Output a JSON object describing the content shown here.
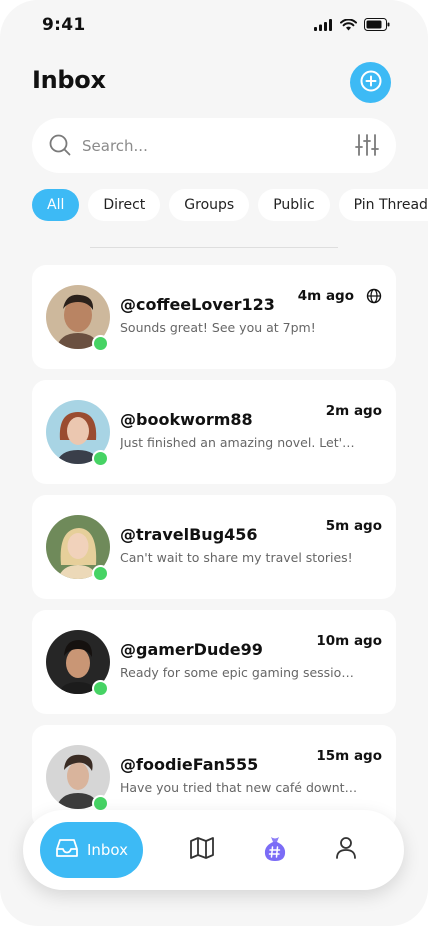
{
  "status_bar": {
    "time": "9:41"
  },
  "header": {
    "title": "Inbox",
    "add_icon": "plus-circle-icon"
  },
  "search": {
    "placeholder": "Search...",
    "value": "",
    "filter_icon": "sliders-icon"
  },
  "filters": [
    "All",
    "Direct",
    "Groups",
    "Public",
    "Pin Threads"
  ],
  "active_filter": "All",
  "messages": [
    {
      "handle": "@coffeeLover123",
      "preview": "Sounds great! See you at 7pm!",
      "time": "4m ago",
      "public": true,
      "online": true
    },
    {
      "handle": "@bookworm88",
      "preview": "Just finished an amazing novel. Let's ...",
      "time": "2m ago",
      "public": false,
      "online": true
    },
    {
      "handle": "@travelBug456",
      "preview": "Can't wait to share my travel stories!",
      "time": "5m ago",
      "public": false,
      "online": true
    },
    {
      "handle": "@gamerDude99",
      "preview": "Ready for some epic gaming sessions...",
      "time": "10m ago",
      "public": false,
      "online": true
    },
    {
      "handle": "@foodieFan555",
      "preview": "Have you tried that new café downtown...",
      "time": "15m ago",
      "public": false,
      "online": true
    }
  ],
  "nav": {
    "inbox_label": "Inbox",
    "items": [
      "inbox-icon",
      "map-icon",
      "hashtag-bag-icon",
      "profile-icon"
    ]
  },
  "colors": {
    "accent": "#3dbaf5",
    "online": "#46d364",
    "purple": "#7b6cf6"
  }
}
